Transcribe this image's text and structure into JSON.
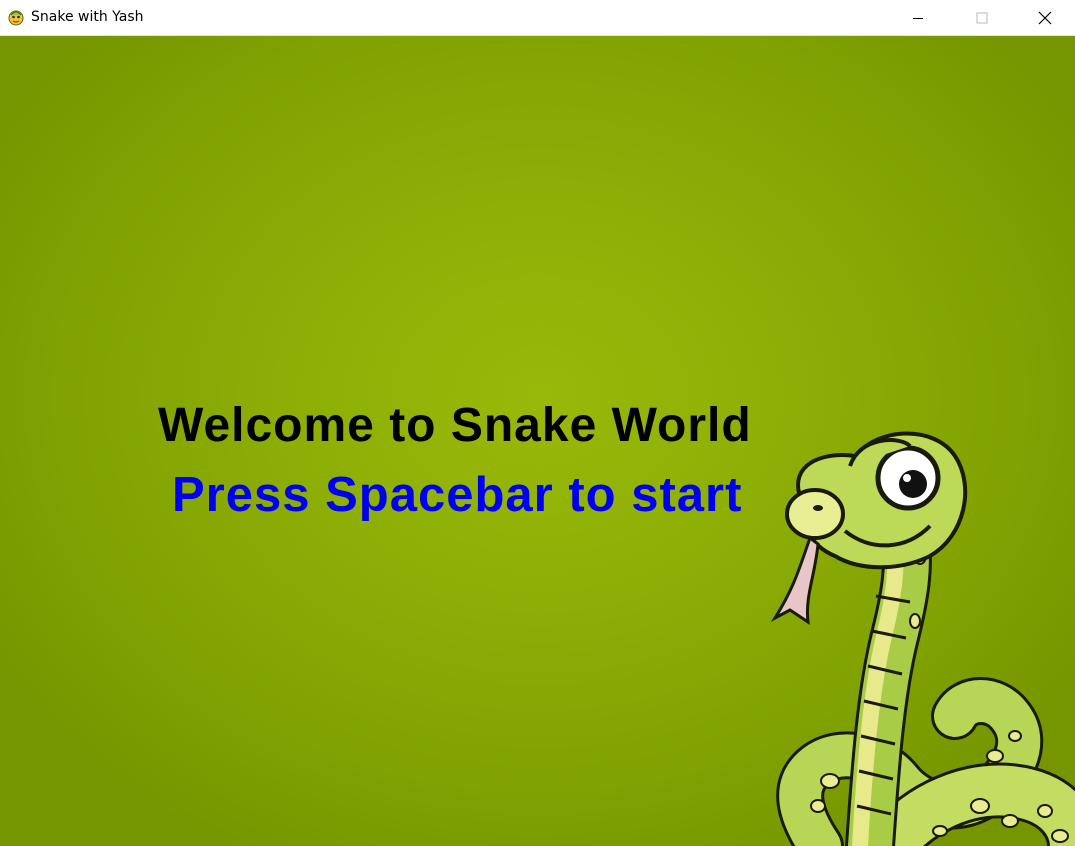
{
  "window": {
    "title": "Snake with Yash",
    "controls": {
      "minimize_icon": "minimize-icon",
      "maximize_icon": "maximize-icon",
      "close_icon": "close-icon"
    },
    "app_icon": "pygame-snake-icon"
  },
  "screen": {
    "welcome_text": "Welcome to Snake World",
    "prompt_text": "Press Spacebar to start",
    "colors": {
      "background": "#8dae06",
      "welcome_text": "#000000",
      "prompt_text": "#0000ee"
    },
    "mascot": "cartoon-snake-illustration"
  }
}
